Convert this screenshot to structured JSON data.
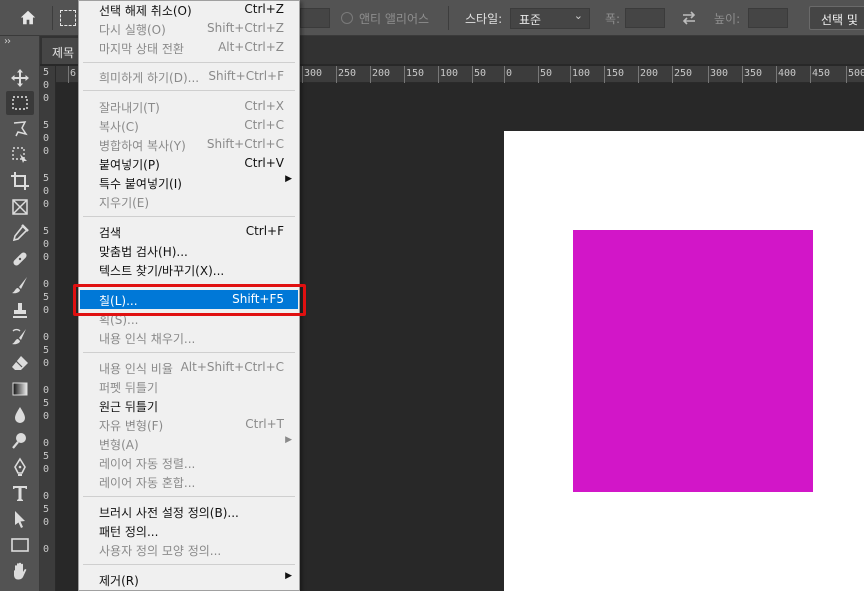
{
  "options_bar": {
    "anti_alias_label": "앤티 앨리어스",
    "style_label": "스타일:",
    "style_value": "표준",
    "width_label": "폭:",
    "height_label": "높이:",
    "select_mask_label": "선택 및"
  },
  "document": {
    "tab_title": "제목"
  },
  "ruler": {
    "h_labels": [
      "6",
      "300",
      "250",
      "200",
      "150",
      "100",
      "50",
      "0",
      "50",
      "100",
      "150",
      "200",
      "250",
      "300",
      "350",
      "400",
      "450",
      "500"
    ],
    "v_digits": [
      "5",
      "0",
      "0",
      "5",
      "0",
      "0",
      "5",
      "0",
      "0",
      "5",
      "0",
      "0",
      "0",
      "5",
      "0",
      "0",
      "5",
      "0",
      "0",
      "5",
      "0",
      "0",
      "5",
      "0",
      "0",
      "5",
      "0",
      "0"
    ]
  },
  "canvas": {
    "shape_color": "#d216c8",
    "canvas_color": "#ffffff"
  },
  "edit_menu": {
    "items": [
      {
        "label": "선택 해제 취소(O)",
        "shortcut": "Ctrl+Z",
        "enabled": true
      },
      {
        "label": "다시 실행(O)",
        "shortcut": "Shift+Ctrl+Z",
        "enabled": false
      },
      {
        "label": "마지막 상태 전환",
        "shortcut": "Alt+Ctrl+Z",
        "enabled": false
      },
      {
        "label": "희미하게 하기(D)...",
        "shortcut": "Shift+Ctrl+F",
        "enabled": false
      },
      {
        "label": "잘라내기(T)",
        "shortcut": "Ctrl+X",
        "enabled": false
      },
      {
        "label": "복사(C)",
        "shortcut": "Ctrl+C",
        "enabled": false
      },
      {
        "label": "병합하여 복사(Y)",
        "shortcut": "Shift+Ctrl+C",
        "enabled": false
      },
      {
        "label": "붙여넣기(P)",
        "shortcut": "Ctrl+V",
        "enabled": true
      },
      {
        "label": "특수 붙여넣기(I)",
        "shortcut": "",
        "enabled": true,
        "submenu": true
      },
      {
        "label": "지우기(E)",
        "shortcut": "",
        "enabled": false
      },
      {
        "label": "검색",
        "shortcut": "Ctrl+F",
        "enabled": true
      },
      {
        "label": "맞춤법 검사(H)...",
        "shortcut": "",
        "enabled": true
      },
      {
        "label": "텍스트 찾기/바꾸기(X)...",
        "shortcut": "",
        "enabled": true
      },
      {
        "label": "칠(L)...",
        "shortcut": "Shift+F5",
        "enabled": true,
        "highlighted": true
      },
      {
        "label": "획(S)...",
        "shortcut": "",
        "enabled": false
      },
      {
        "label": "내용 인식 채우기...",
        "shortcut": "",
        "enabled": false
      },
      {
        "label": "내용 인식 비율",
        "shortcut": "Alt+Shift+Ctrl+C",
        "enabled": false
      },
      {
        "label": "퍼펫 뒤틀기",
        "shortcut": "",
        "enabled": false
      },
      {
        "label": "원근 뒤틀기",
        "shortcut": "",
        "enabled": true
      },
      {
        "label": "자유 변형(F)",
        "shortcut": "Ctrl+T",
        "enabled": false
      },
      {
        "label": "변형(A)",
        "shortcut": "",
        "enabled": false,
        "submenu": true
      },
      {
        "label": "레이어 자동 정렬...",
        "shortcut": "",
        "enabled": false
      },
      {
        "label": "레이어 자동 혼합...",
        "shortcut": "",
        "enabled": false
      },
      {
        "label": "브러시 사전 설정 정의(B)...",
        "shortcut": "",
        "enabled": true
      },
      {
        "label": "패턴 정의...",
        "shortcut": "",
        "enabled": true
      },
      {
        "label": "사용자 정의 모양 정의...",
        "shortcut": "",
        "enabled": false
      },
      {
        "label": "제거(R)",
        "shortcut": "",
        "enabled": true,
        "submenu": true
      }
    ]
  },
  "colors": {
    "highlight": "#0078d7",
    "callout": "#e01010"
  }
}
